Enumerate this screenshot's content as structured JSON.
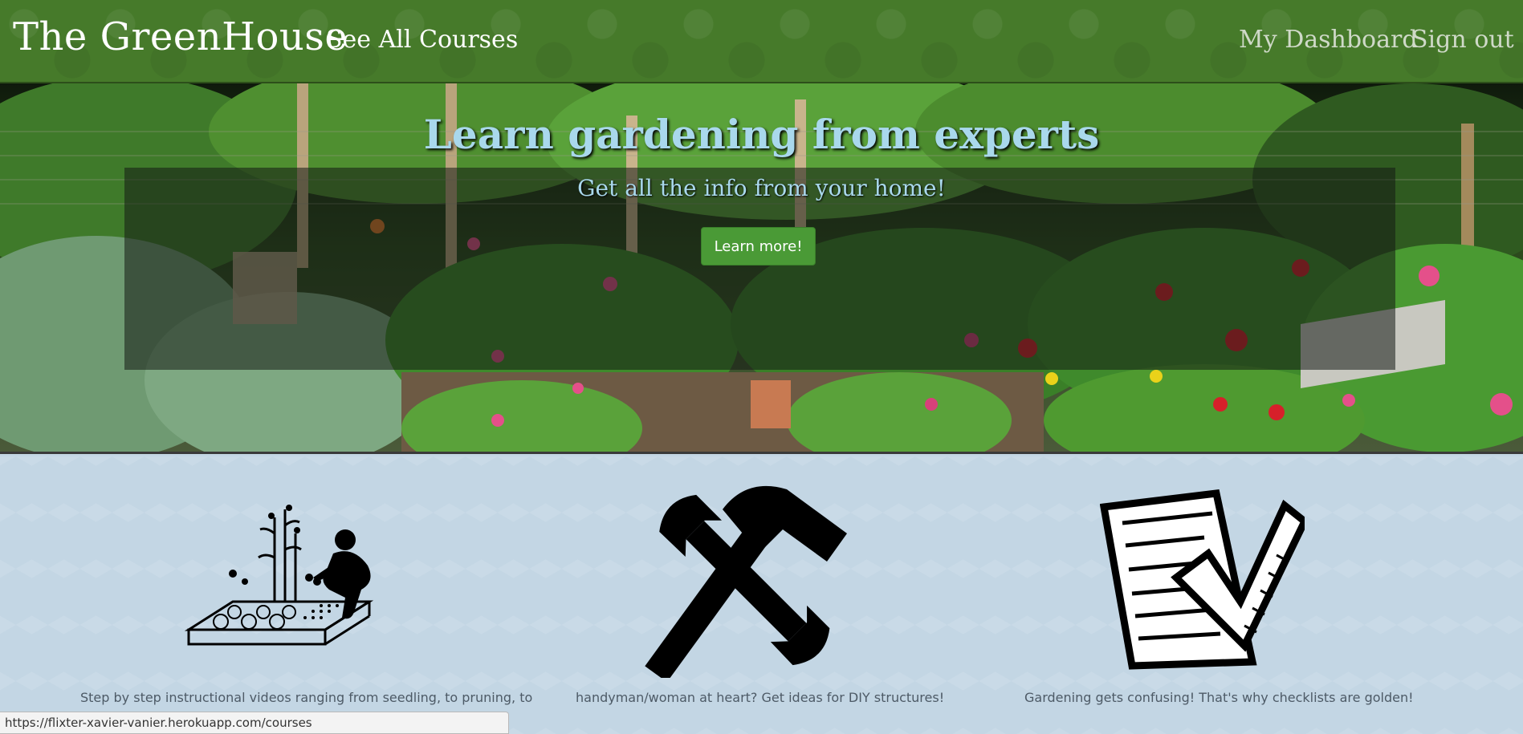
{
  "navbar": {
    "brand": "The GreenHouse",
    "courses_link": "See All Courses",
    "dashboard_link": "My Dashboard",
    "signout_link": "Sign out",
    "background_color": "#467a2a"
  },
  "hero": {
    "heading": "Learn gardening from experts",
    "subheading": "Get all the info from your home!",
    "button_label": "Learn more!",
    "heading_color": "#a9d8ec",
    "button_color": "#4a9a36"
  },
  "features": [
    {
      "icon": "gardener-raised-bed-icon",
      "text": "Step by step instructional videos ranging from seedling, to pruning, to"
    },
    {
      "icon": "wrench-hammer-tools-icon",
      "text": "handyman/woman at heart? Get ideas for DIY structures!"
    },
    {
      "icon": "checklist-icon",
      "text": "Gardening gets confusing! That's why checklists are golden!"
    }
  ],
  "status_bar": {
    "url": "https://flixter-xavier-vanier.herokuapp.com/courses"
  }
}
